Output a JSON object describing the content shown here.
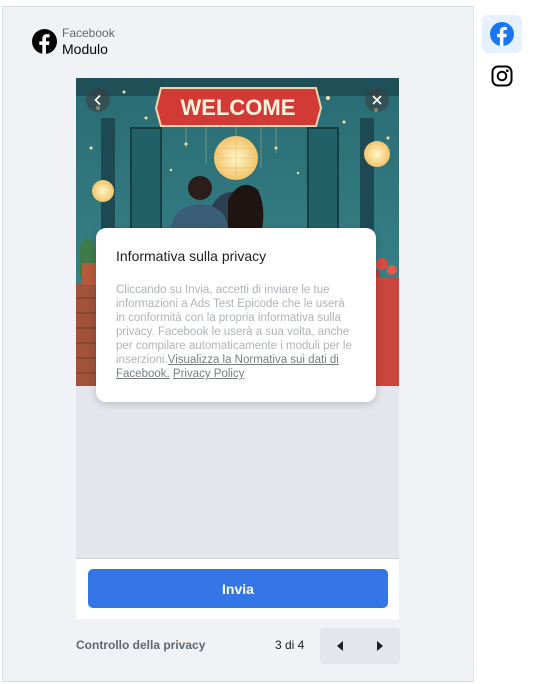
{
  "header": {
    "platform_label": "Facebook",
    "format_label": "Modulo"
  },
  "ad_image": {
    "sign_text": "WELCOME"
  },
  "privacy_card": {
    "title": "Informativa sulla privacy",
    "body_text": "Cliccando su Invia, accetti di inviare le tue informazioni a Ads Test Epicode che le userà in conformità con la propria informativa sulla privacy. Facebook le userà a sua volta, anche per compilare automaticamente i moduli per le inserzioni.",
    "data_policy_link": "Visualizza la Normativa sui dati di Facebook.",
    "privacy_policy_link": "Privacy Policy"
  },
  "cta": {
    "send_label": "Invia"
  },
  "footer": {
    "section_label": "Controllo della privacy",
    "page_indicator": "3 di 4"
  },
  "platforms": [
    {
      "name": "facebook-icon",
      "active": true
    },
    {
      "name": "instagram-icon",
      "active": false
    }
  ],
  "colors": {
    "accent": "#3476e5",
    "facebook_blue": "#1877f2",
    "background": "#f0f2f5"
  }
}
